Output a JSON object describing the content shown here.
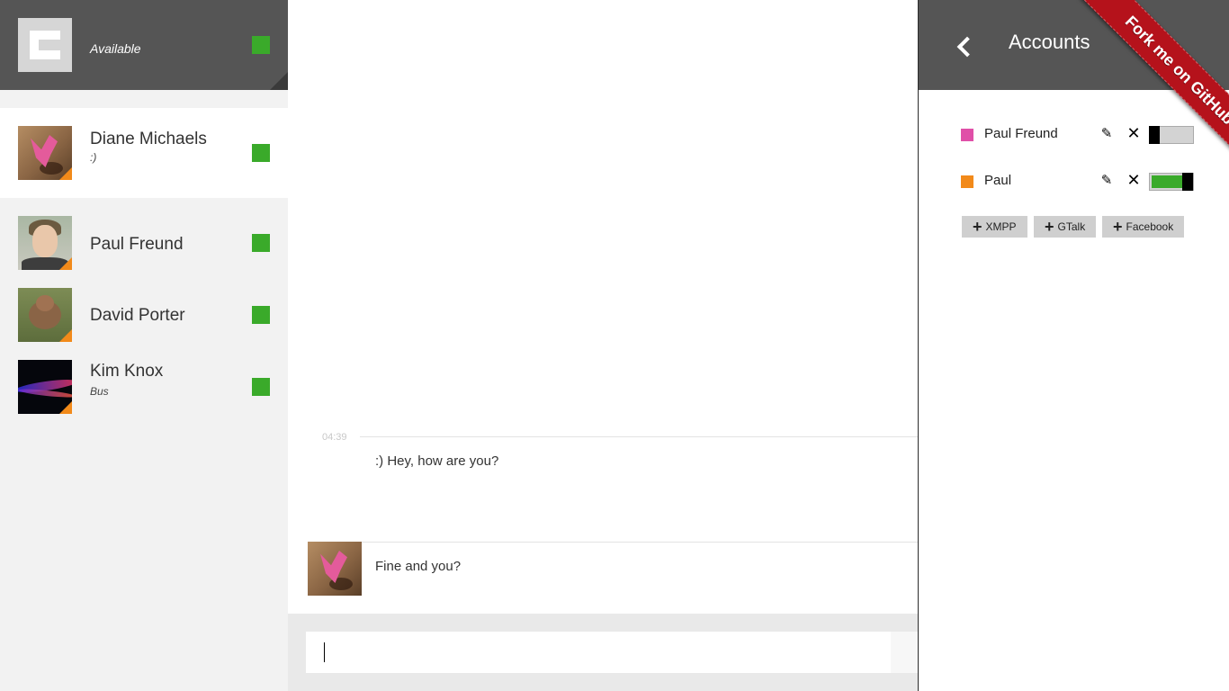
{
  "me": {
    "status_text": "Available",
    "status_color": "#3aaa2a"
  },
  "contacts": [
    {
      "name": "Diane Michaels",
      "message": ":)"
    },
    {
      "name": "Paul Freund",
      "message": ""
    },
    {
      "name": "David Porter",
      "message": ""
    },
    {
      "name": "Kim Knox",
      "message": "Bus"
    }
  ],
  "chat": {
    "messages": [
      {
        "time": "04:39",
        "text": ":) Hey, how are you?"
      },
      {
        "text": "Fine and you?"
      }
    ],
    "input_value": ""
  },
  "accounts": {
    "title": "Accounts",
    "items": [
      {
        "name": "Paul Freund",
        "color": "#e04fa8",
        "enabled_fraction": 0
      },
      {
        "name": "Paul",
        "color": "#f28a1a",
        "enabled_fraction": 1
      }
    ],
    "add_buttons": [
      "XMPP",
      "GTalk",
      "Facebook"
    ]
  },
  "ribbon": {
    "text": "Fork me on GitHub"
  },
  "colors": {
    "header_bg": "#555555",
    "online": "#3aaa2a",
    "ribbon": "#b5121b"
  }
}
